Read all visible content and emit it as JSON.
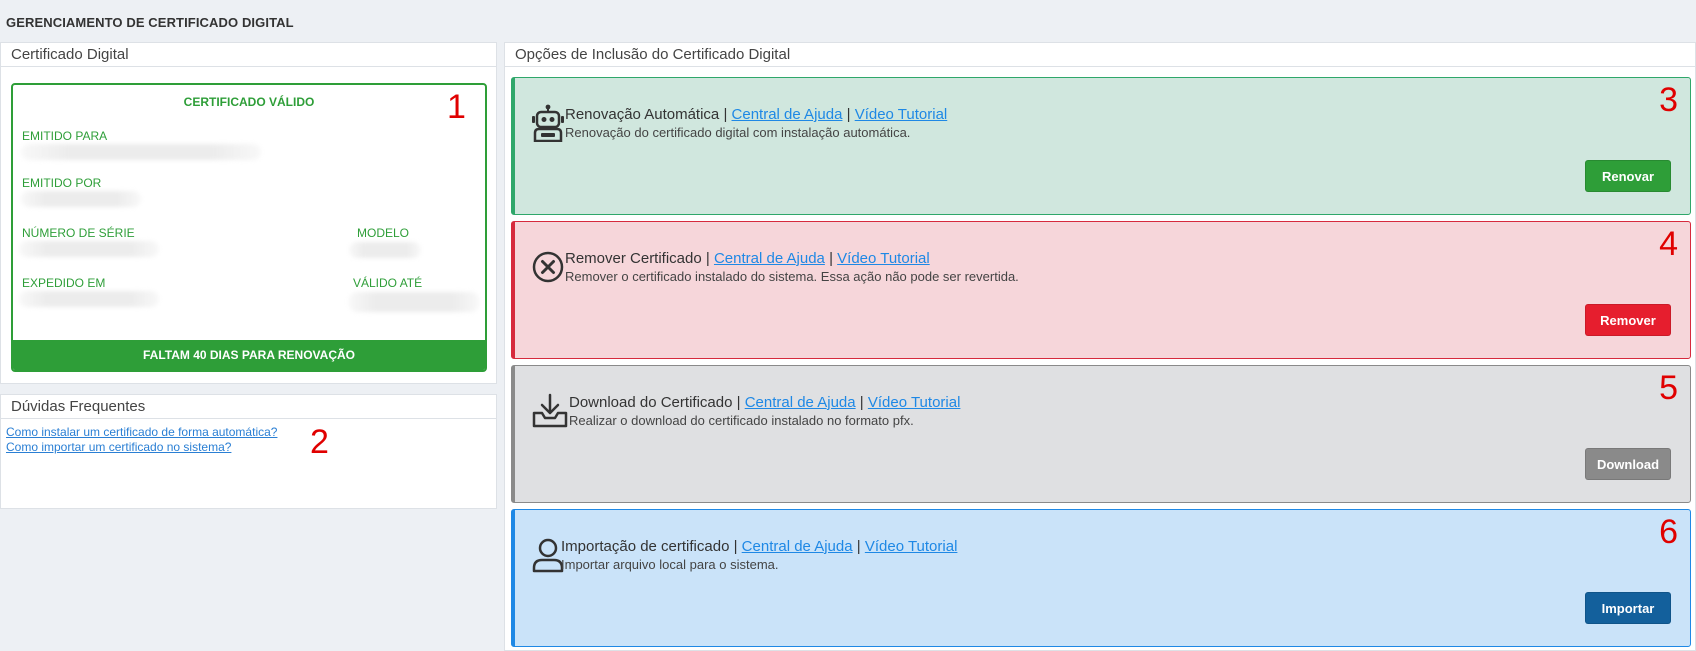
{
  "page": {
    "title": "GERENCIAMENTO DE CERTIFICADO DIGITAL"
  },
  "certificate": {
    "panel_title": "Certificado Digital",
    "status": "CERTIFICADO VÁLIDO",
    "fields": {
      "issued_to": "EMITIDO PARA",
      "issued_by": "EMITIDO POR",
      "serial": "NÚMERO DE SÉRIE",
      "model": "MODELO",
      "issued_on": "EXPEDIDO EM",
      "valid_until": "VÁLIDO ATÉ"
    },
    "footer": "FALTAM 40 DIAS PARA RENOVAÇÃO"
  },
  "faq": {
    "panel_title": "Dúvidas Frequentes",
    "links": [
      "Como instalar um certificado de forma automática?",
      "Como importar um certificado no sistema?"
    ]
  },
  "options": {
    "panel_title": "Opções de Inclusão do Certificado Digital",
    "separator": "|",
    "items": [
      {
        "title": "Renovação Automática",
        "help": "Central de Ajuda",
        "video": "Vídeo Tutorial",
        "desc": "Renovação do certificado digital com instalação automática.",
        "button": "Renovar",
        "icon": "robot-icon"
      },
      {
        "title": "Remover Certificado",
        "help": "Central de Ajuda",
        "video": "Vídeo Tutorial",
        "desc": "Remover o certificado instalado do sistema. Essa ação não pode ser revertida.",
        "button": "Remover",
        "icon": "close-circle-icon"
      },
      {
        "title": "Download do Certificado",
        "help": "Central de Ajuda",
        "video": "Vídeo Tutorial",
        "desc": "Realizar o download do certificado instalado no formato pfx.",
        "button": "Download",
        "icon": "download-tray-icon"
      },
      {
        "title": "Importação de certificado",
        "help": "Central de Ajuda",
        "video": "Vídeo Tutorial",
        "desc": "Importar arquivo local para o sistema.",
        "button": "Importar",
        "icon": "user-icon"
      }
    ]
  },
  "markers": [
    "1",
    "2",
    "3",
    "4",
    "5",
    "6"
  ],
  "colors": {
    "success": "#2e9e38",
    "danger": "#e61e2e",
    "neutral": "#8a8a8a",
    "primary": "#13609c",
    "link": "#1e88e5",
    "marker": "#e00000"
  }
}
